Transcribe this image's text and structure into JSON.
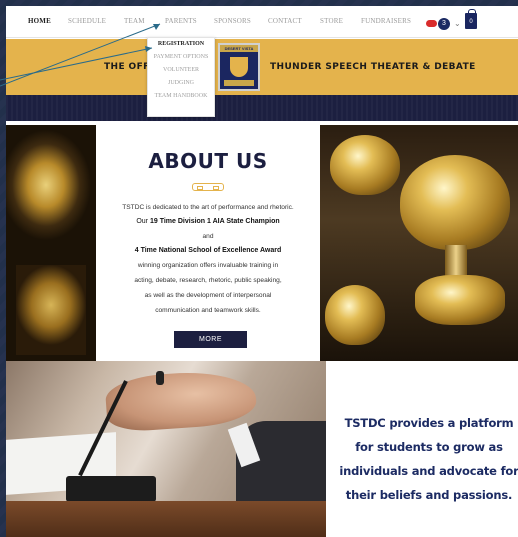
{
  "nav": {
    "items": [
      "HOME",
      "SCHEDULE",
      "TEAM",
      "PARENTS",
      "SPONSORS",
      "CONTACT",
      "STORE",
      "FUNDRAISERS"
    ],
    "active": "HOME",
    "notification_count": "3",
    "cart_count": "0"
  },
  "dropdown": {
    "items": [
      "REGISTRATION",
      "PAYMENT OPTIONS",
      "VOLUNTEER",
      "JUDGING",
      "TEAM HANDBOOK"
    ]
  },
  "banner": {
    "left_text": "THE OFFI",
    "right_text": "THUNDER SPEECH THEATER & DEBATE",
    "crest_label": "DESERT VISTA"
  },
  "about": {
    "title": "ABOUT US",
    "line1": "TSTDC is dedicated to the art of performance and rhetoric.",
    "line2_prefix": "Our ",
    "line2_bold": "19 Time Division 1 AIA State Champion",
    "line3": "and",
    "line4": "4 Time National School of Excellence Award",
    "line5": "winning organization offers invaluable training in",
    "line6": "acting, debate, research, rhetoric, public speaking,",
    "line7": "as well as the development of interpersonal",
    "line8": "communication and teamwork skills.",
    "button": "MORE"
  },
  "tagline": {
    "lines": [
      "TSTDC provides a platform",
      "for students to grow as",
      "individuals and advocate for",
      "their beliefs and passions."
    ]
  },
  "colors": {
    "navy": "#1c1f40",
    "gold": "#e4b34c",
    "accent_blue": "#1c2b63"
  }
}
